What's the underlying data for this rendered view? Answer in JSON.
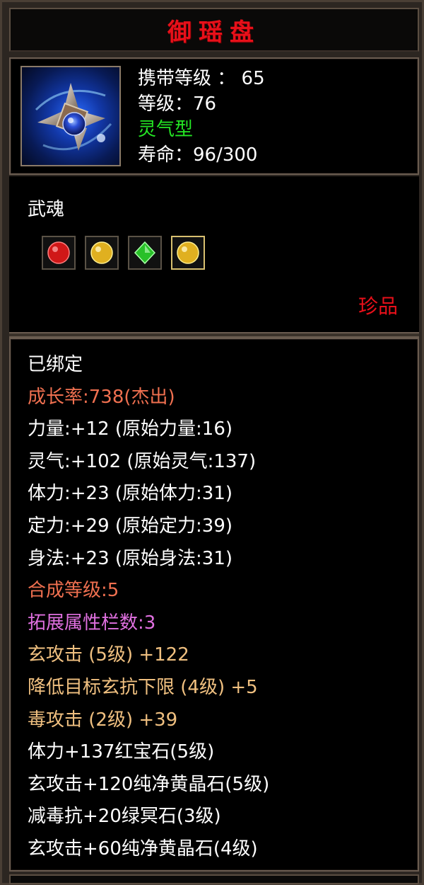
{
  "item": {
    "title": "御瑶盘",
    "icon": "spinning-wheel-weapon-icon",
    "info": [
      {
        "text": "携带等级 ： 65",
        "color": "#ffffff"
      },
      {
        "text": "等级：76",
        "color": "#ffffff"
      },
      {
        "text": "灵气型",
        "color": "#24e524"
      },
      {
        "text": "寿命：96/300",
        "color": "#ffffff"
      }
    ]
  },
  "soul": {
    "label": "武魂",
    "gems": [
      {
        "icon": "red-gem-icon",
        "color": "#d01818",
        "highlight": false
      },
      {
        "icon": "yellow-gem-icon",
        "color": "#e0b020",
        "highlight": false
      },
      {
        "icon": "green-gem-icon",
        "color": "#28c028",
        "highlight": false
      },
      {
        "icon": "yellow-gem-icon",
        "color": "#e0b020",
        "highlight": true
      }
    ],
    "rarity": "珍品"
  },
  "stats": [
    {
      "text": "已绑定",
      "color": "#ffffff"
    },
    {
      "text": "成长率:738(杰出)",
      "color": "#f07050"
    },
    {
      "text": "力量:+12 (原始力量:16)",
      "color": "#ffffff"
    },
    {
      "text": "灵气:+102 (原始灵气:137)",
      "color": "#ffffff"
    },
    {
      "text": "体力:+23 (原始体力:31)",
      "color": "#ffffff"
    },
    {
      "text": "定力:+29 (原始定力:39)",
      "color": "#ffffff"
    },
    {
      "text": "身法:+23 (原始身法:31)",
      "color": "#ffffff"
    },
    {
      "text": "合成等级:5",
      "color": "#f07050"
    },
    {
      "text": "拓展属性栏数:3",
      "color": "#e070e0"
    },
    {
      "text": "玄攻击 (5级) +122",
      "color": "#f0c080"
    },
    {
      "text": "降低目标玄抗下限 (4级) +5",
      "color": "#f0c080"
    },
    {
      "text": "毒攻击 (2级) +39",
      "color": "#f0c080"
    },
    {
      "text": "体力+137红宝石(5级)",
      "color": "#ffffff"
    },
    {
      "text": "玄攻击+120纯净黄晶石(5级)",
      "color": "#ffffff"
    },
    {
      "text": "减毒抗+20绿冥石(3级)",
      "color": "#ffffff"
    },
    {
      "text": "玄攻击+60纯净黄晶石(4级)",
      "color": "#ffffff"
    }
  ]
}
